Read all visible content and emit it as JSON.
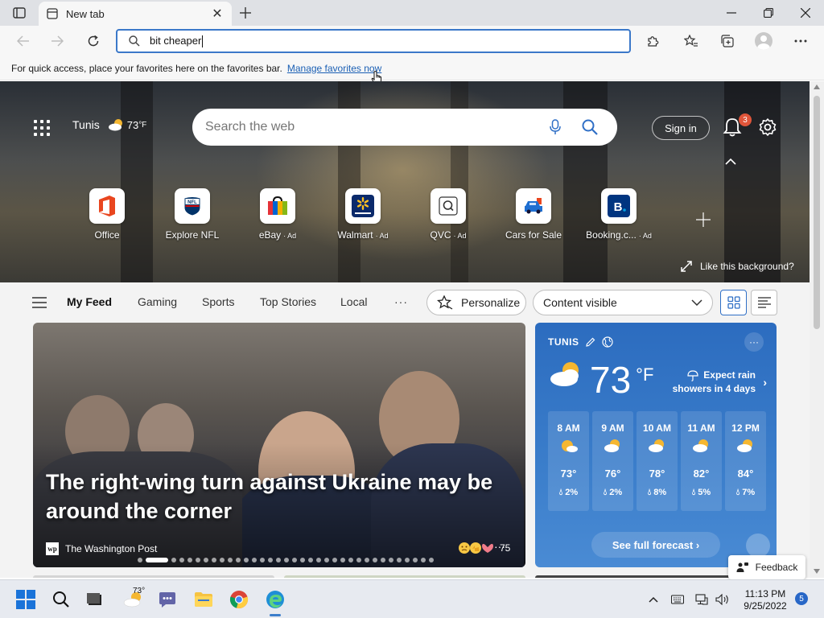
{
  "browser": {
    "tab_title": "New tab",
    "address_value": "bit cheaper"
  },
  "favbar": {
    "hint": "For quick access, place your favorites here on the favorites bar.",
    "link": "Manage favorites now"
  },
  "hero": {
    "city": "Tunis",
    "temp": "73",
    "temp_unit": "°F",
    "search_placeholder": "Search the web",
    "sign_in": "Sign in",
    "notification_count": "3",
    "like_background": "Like this background?",
    "tiles": [
      {
        "label": "Office",
        "ad": ""
      },
      {
        "label": "Explore NFL",
        "ad": ""
      },
      {
        "label": "eBay",
        "ad": "· Ad"
      },
      {
        "label": "Walmart",
        "ad": "· Ad"
      },
      {
        "label": "QVC",
        "ad": "· Ad"
      },
      {
        "label": "Cars for Sale",
        "ad": ""
      },
      {
        "label": "Booking.c...",
        "ad": "· Ad"
      }
    ]
  },
  "feed": {
    "tabs": [
      "My Feed",
      "Gaming",
      "Sports",
      "Top Stories",
      "Local"
    ],
    "more": "···",
    "personalize": "Personalize",
    "content_visible": "Content visible"
  },
  "story": {
    "headline": "The right-wing turn against Ukraine may be around the corner",
    "source": "The Washington Post",
    "source_logo": "wp",
    "reaction_count": "75",
    "more": "···"
  },
  "weather": {
    "city": "TUNIS",
    "temp": "73",
    "unit": "°F",
    "alert_line1": "Expect rain",
    "alert_line2": "showers in 4 days",
    "hours": [
      {
        "time": "8 AM",
        "temp": "73°",
        "precip": "2%"
      },
      {
        "time": "9 AM",
        "temp": "76°",
        "precip": "2%"
      },
      {
        "time": "10 AM",
        "temp": "78°",
        "precip": "8%"
      },
      {
        "time": "11 AM",
        "temp": "82°",
        "precip": "5%"
      },
      {
        "time": "12 PM",
        "temp": "84°",
        "precip": "7%"
      }
    ],
    "forecast": "See full forecast ›",
    "more": "···"
  },
  "feedback": "Feedback",
  "taskbar": {
    "weather_temp": "73°",
    "time": "11:13 PM",
    "date": "9/25/2022",
    "notifications": "5"
  },
  "colors": {
    "accent": "#3b78c9",
    "weather_card": "#2c6cbf",
    "badge": "#e0553a"
  }
}
